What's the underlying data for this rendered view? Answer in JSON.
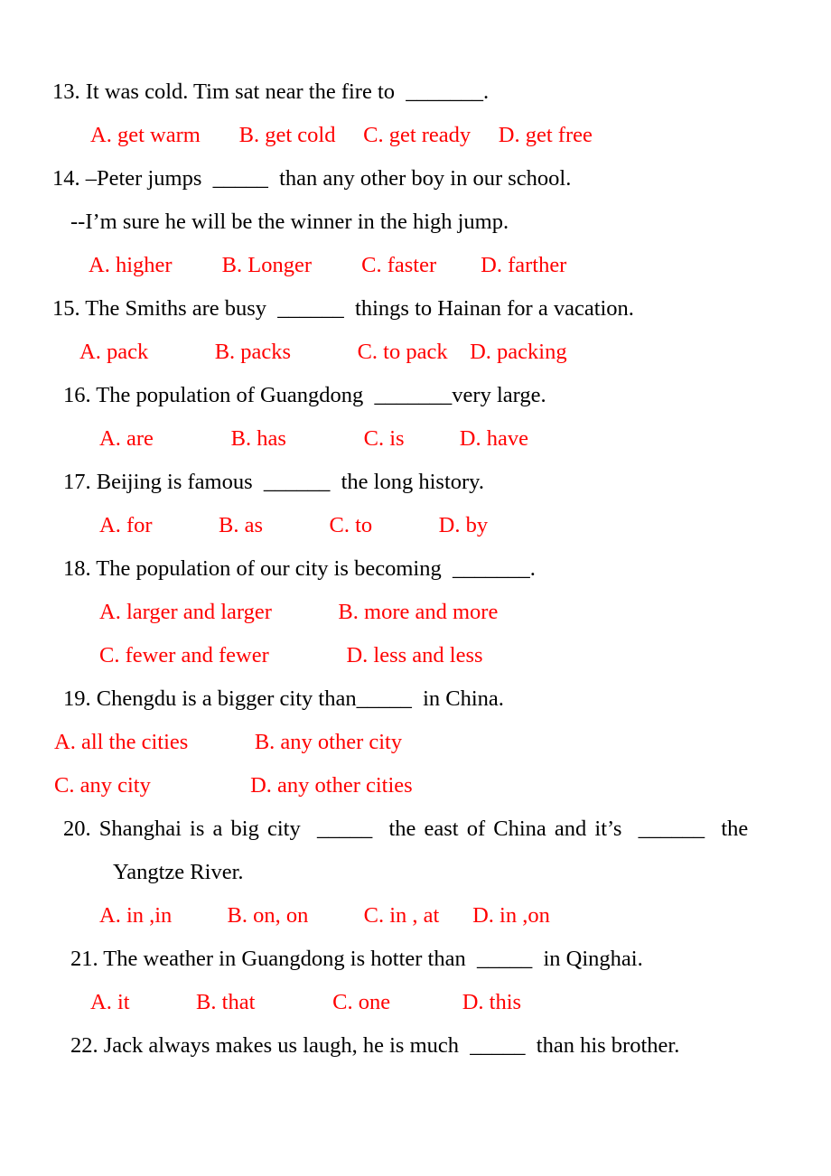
{
  "document": {
    "type": "english-grammar-multiple-choice-worksheet",
    "text_color": "#000000",
    "option_color": "#ff0000",
    "background_color": "#ffffff"
  },
  "questions": [
    {
      "number": "13.",
      "stem_before": " It was cold. Tim sat near the fire to  ",
      "blank": "_______",
      "stem_after": ".",
      "option_layout": "one-row",
      "options": [
        {
          "label": "A.",
          "text": " get warm"
        },
        {
          "label": "B.",
          "text": " get cold"
        },
        {
          "label": "C.",
          "text": " get ready"
        },
        {
          "label": "D.",
          "text": " get free"
        }
      ],
      "options_line": "A. get warm       B. get cold     C. get ready     D. get free"
    },
    {
      "number": "14.",
      "stem_before": " –Peter jumps  ",
      "blank": "_____",
      "stem_after": "  than any other boy in our school.",
      "continuation": "--I’m sure he will be the winner in the high jump.",
      "option_layout": "one-row",
      "options": [
        {
          "label": "A.",
          "text": " higher"
        },
        {
          "label": "B.",
          "text": " Longer"
        },
        {
          "label": "C.",
          "text": " faster"
        },
        {
          "label": "D.",
          "text": " farther"
        }
      ],
      "options_line": "A. higher         B. Longer         C. faster        D. farther"
    },
    {
      "number": "15.",
      "stem_before": " The Smiths are busy  ",
      "blank": "______",
      "stem_after": "  things to Hainan for a vacation.",
      "option_layout": "one-row",
      "options": [
        {
          "label": "A.",
          "text": " pack"
        },
        {
          "label": "B.",
          "text": " packs"
        },
        {
          "label": "C.",
          "text": " to pack"
        },
        {
          "label": "D.",
          "text": " packing"
        }
      ],
      "options_line": "A. pack            B. packs            C. to pack    D. packing"
    },
    {
      "number": "16.",
      "stem_before": " The population of Guangdong  ",
      "blank": "_______",
      "stem_after": "very large.",
      "option_layout": "one-row",
      "options": [
        {
          "label": "A.",
          "text": " are"
        },
        {
          "label": "B.",
          "text": " has"
        },
        {
          "label": "C.",
          "text": " is"
        },
        {
          "label": "D.",
          "text": " have"
        }
      ],
      "options_line": "A. are              B. has              C. is          D. have"
    },
    {
      "number": "17.",
      "stem_before": " Beijing is famous  ",
      "blank": "______",
      "stem_after": "  the long history.",
      "option_layout": "one-row",
      "options": [
        {
          "label": "A.",
          "text": " for"
        },
        {
          "label": "B.",
          "text": " as"
        },
        {
          "label": "C.",
          "text": " to"
        },
        {
          "label": "D.",
          "text": " by"
        }
      ],
      "options_line": "A. for            B. as            C. to            D. by"
    },
    {
      "number": "18.",
      "stem_before": " The population of our city is becoming  ",
      "blank": "_______",
      "stem_after": ".",
      "option_layout": "two-column",
      "options": [
        {
          "label": "A.",
          "text": " larger and larger"
        },
        {
          "label": "B.",
          "text": " more and more"
        },
        {
          "label": "C.",
          "text": " fewer and fewer"
        },
        {
          "label": "D.",
          "text": " less and less"
        }
      ],
      "options_row_1": "A. larger and larger            B. more and more",
      "options_row_2": "C. fewer and fewer              D. less and less"
    },
    {
      "number": "19.",
      "stem_before": " Chengdu is a bigger city than",
      "blank": "_____",
      "stem_after": "  in China.",
      "option_layout": "two-column",
      "options": [
        {
          "label": "A.",
          "text": " all the cities"
        },
        {
          "label": "B.",
          "text": " any other city"
        },
        {
          "label": "C.",
          "text": " any city"
        },
        {
          "label": "D.",
          "text": " any other cities"
        }
      ],
      "options_row_1": "A. all the cities            B. any other city",
      "options_row_2": "C. any city                  D. any other cities"
    },
    {
      "number": "20.",
      "stem_before": " Shanghai is a big city  ",
      "blank": "_____",
      "stem_after": "  the east of China and it’s  ",
      "blank2": "______",
      "stem_after2": "  the",
      "continuation": "Yangtze River.",
      "option_layout": "one-row",
      "options": [
        {
          "label": "A.",
          "text": " in ,in"
        },
        {
          "label": "B.",
          "text": " on, on"
        },
        {
          "label": "C.",
          "text": " in , at"
        },
        {
          "label": "D.",
          "text": " in ,on"
        }
      ],
      "options_line": "A. in ,in          B. on, on          C. in , at      D. in ,on"
    },
    {
      "number": "21.",
      "stem_before": " The weather in Guangdong is hotter than  ",
      "blank": "_____",
      "stem_after": "  in Qinghai.",
      "option_layout": "one-row",
      "options": [
        {
          "label": "A.",
          "text": " it"
        },
        {
          "label": "B.",
          "text": " that"
        },
        {
          "label": "C.",
          "text": " one"
        },
        {
          "label": "D.",
          "text": " this"
        }
      ],
      "options_line": "A. it            B. that              C. one             D. this"
    },
    {
      "number": "22.",
      "stem_before": " Jack always makes us laugh, he is much  ",
      "blank": "_____",
      "stem_after": "  than his brother.",
      "option_layout": "none",
      "options": []
    }
  ]
}
